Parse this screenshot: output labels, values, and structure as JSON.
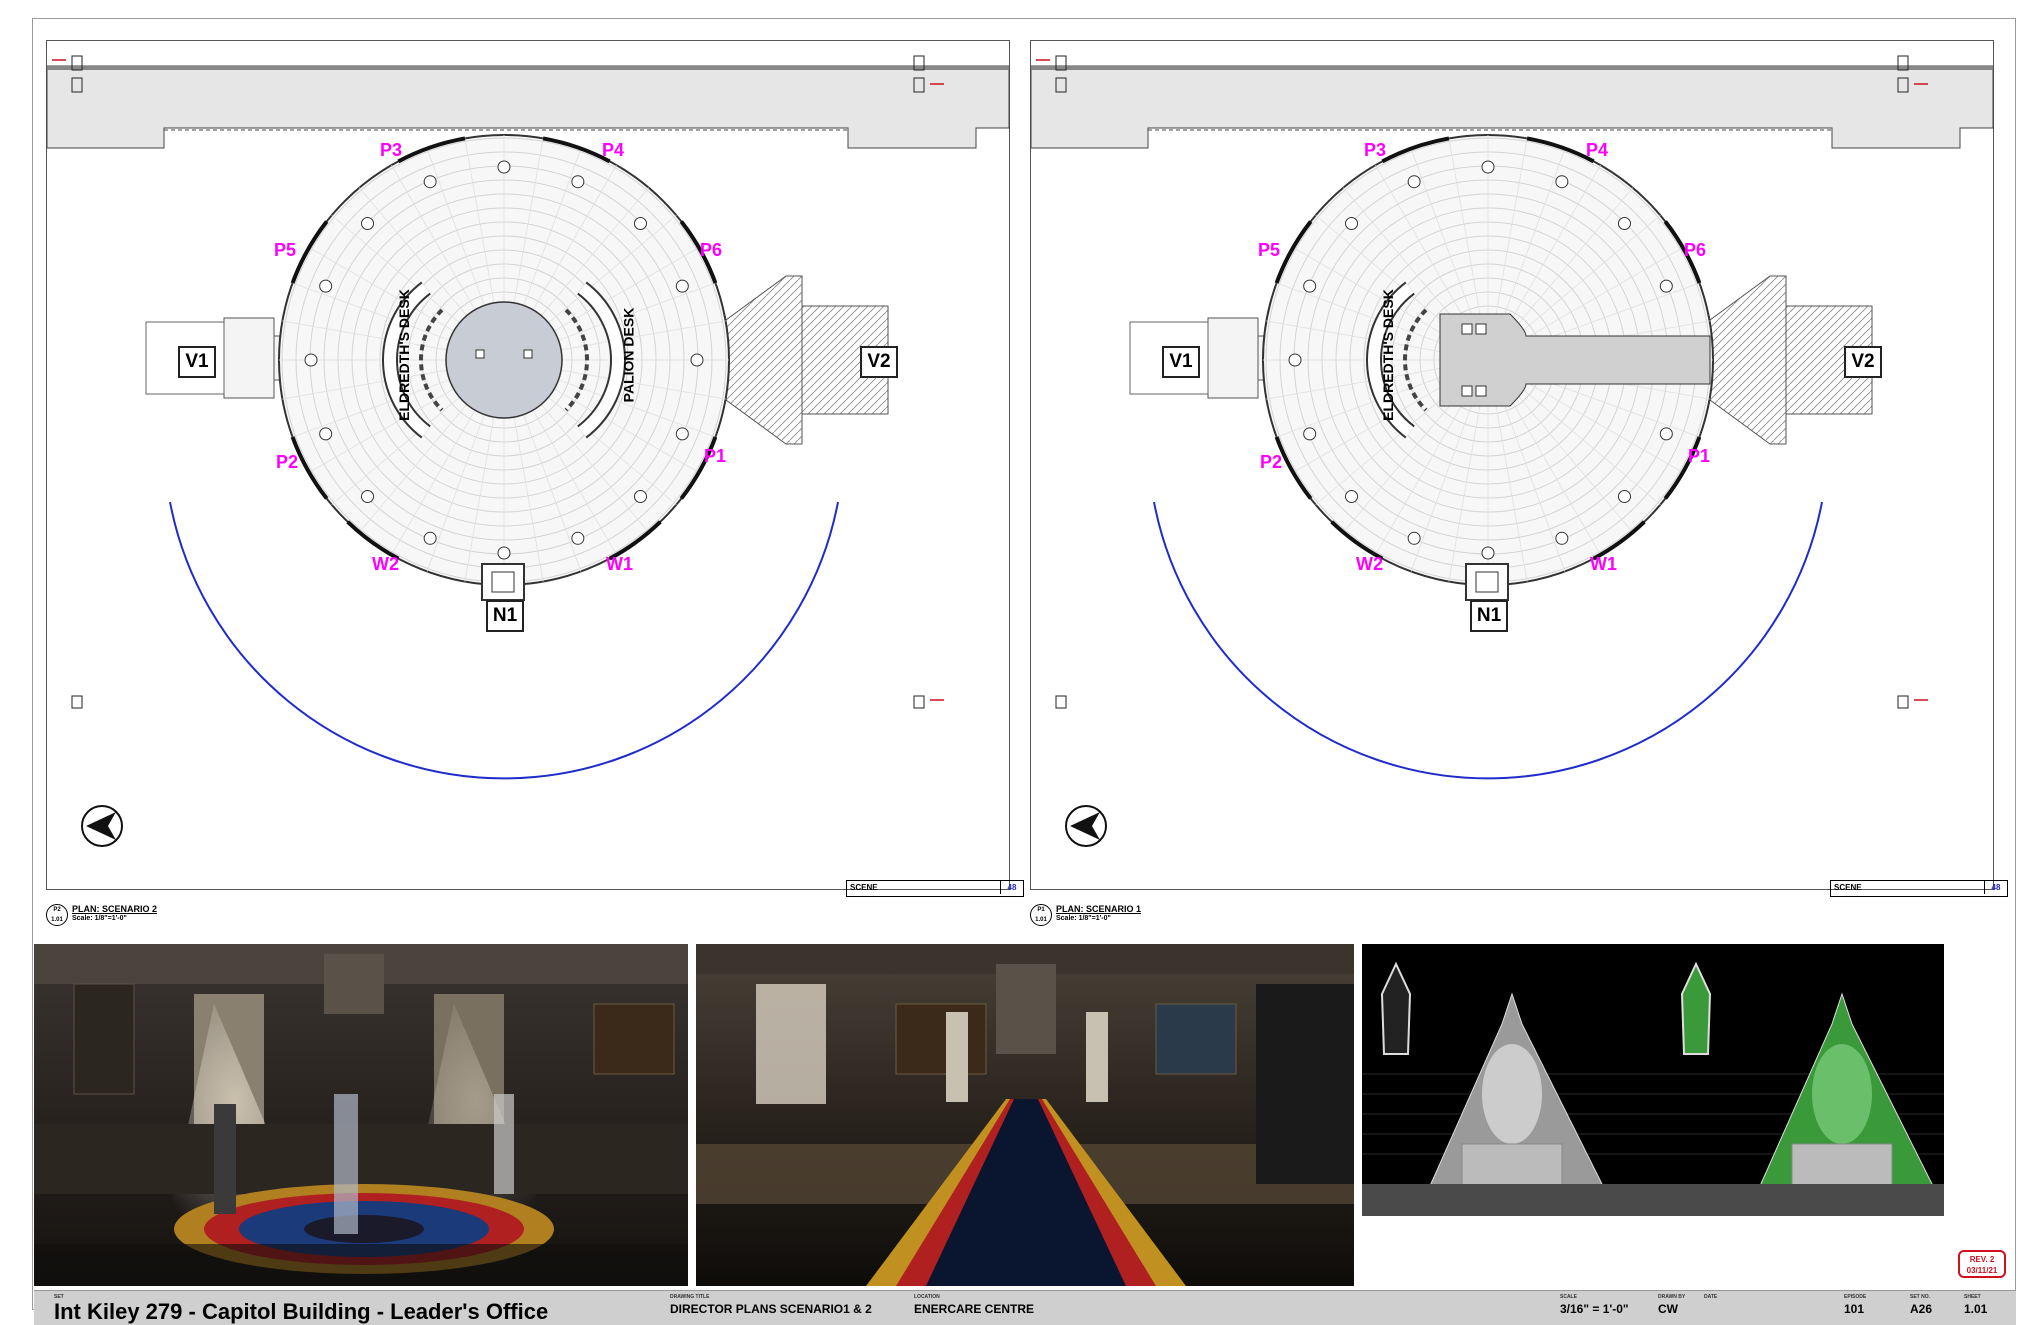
{
  "plans": [
    {
      "id": "scenario2",
      "desk_left": "ELDREDTH'S DESK",
      "desk_right": "PALION DESK",
      "labels": {
        "p1": "P1",
        "p2": "P2",
        "p3": "P3",
        "p4": "P4",
        "p5": "P5",
        "p6": "P6",
        "w1": "W1",
        "w2": "W2",
        "v1": "V1",
        "v2": "V2",
        "n1": "N1"
      },
      "scene_label": "SCENE",
      "scene_number": "48",
      "callout_num": "P2",
      "callout_sheet": "1.01",
      "plan_title": "PLAN: SCENARIO 2",
      "plan_scale": "Scale: 1/8\"=1'-0\"",
      "north": "N"
    },
    {
      "id": "scenario1",
      "desk_left": "ELDREDTH'S DESK",
      "labels": {
        "p1": "P1",
        "p2": "P2",
        "p3": "P3",
        "p4": "P4",
        "p5": "P5",
        "p6": "P6",
        "w1": "W1",
        "w2": "W2",
        "v1": "V1",
        "v2": "V2",
        "n1": "N1"
      },
      "scene_label": "SCENE",
      "scene_number": "48",
      "callout_num": "P1",
      "callout_sheet": "1.01",
      "plan_title": "PLAN: SCENARIO 1",
      "plan_scale": "Scale: 1/8\"=1'-0\"",
      "north": "N"
    }
  ],
  "title_block": {
    "set_label": "SET",
    "set_name": "Int Kiley 279 - Capitol Building - Leader's Office",
    "drawing_title_label": "DRAWING TITLE",
    "drawing_title": "DIRECTOR PLANS SCENARIO1 & 2",
    "location_label": "LOCATION",
    "location": "ENERCARE CENTRE",
    "scale_label": "SCALE",
    "scale": "3/16\" = 1'-0\"",
    "drawn_by_label": "DRAWN BY",
    "drawn_by": "CW",
    "date_label": "DATE",
    "episode_label": "EPISODE",
    "episode": "101",
    "set_no_label": "SET NO.",
    "set_no": "A26",
    "sheet_label": "SHEET",
    "sheet": "1.01"
  },
  "revision": {
    "rev": "REV. 2",
    "date": "03/11/21"
  },
  "colors": {
    "pink": "#ff00ff",
    "blue": "#1f2bcb",
    "revision_red": "#d01020",
    "highlight_green": "#3a9a3a"
  }
}
